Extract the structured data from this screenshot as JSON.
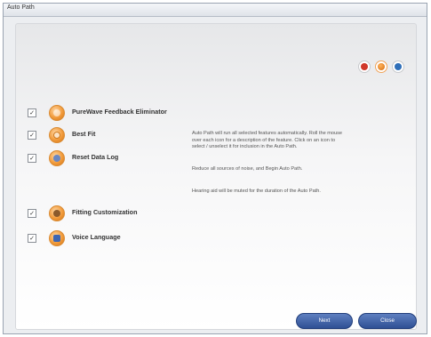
{
  "window": {
    "title": "Auto Path"
  },
  "top_icons": [
    {
      "name": "back-icon",
      "color": "#d0382a"
    },
    {
      "name": "record-icon",
      "color": "#f28b1c"
    },
    {
      "name": "help-icon",
      "color": "#2f6fb9"
    }
  ],
  "features": [
    {
      "label": "PureWave Feedback Eliminator",
      "checked": true,
      "icon": "feedback-eliminator-icon"
    },
    {
      "label": "Best Fit",
      "checked": true,
      "icon": "best-fit-icon"
    },
    {
      "label": "Reset Data Log",
      "checked": true,
      "icon": "reset-data-log-icon"
    },
    {
      "label": "Fitting Customization",
      "checked": true,
      "icon": "fitting-customization-icon"
    },
    {
      "label": "Voice Language",
      "checked": true,
      "icon": "voice-language-icon"
    }
  ],
  "description": {
    "line1": "Auto Path will run all selected features automatically.  Roll the mouse",
    "line2": "over each icon for a description of the feature. Click on an icon to",
    "line3": "select / unselect it for inclusion in the Auto Path.",
    "line4": "Reduce all sources of noise, and Begin Auto Path.",
    "line5": "Hearing aid will be muted for the duration of the Auto Path."
  },
  "buttons": {
    "next": "Next",
    "close": "Close"
  },
  "check_mark": "✓"
}
